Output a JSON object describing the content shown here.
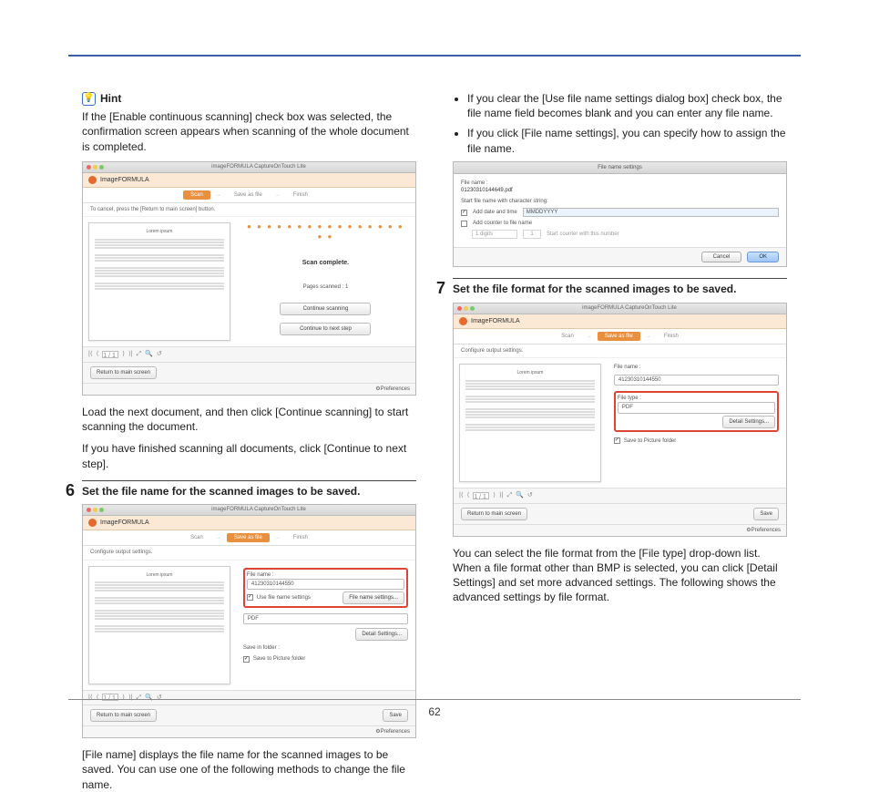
{
  "page_number": "62",
  "left": {
    "hint_label": "Hint",
    "hint_para": "If the [Enable continuous scanning] check box was selected, the confirmation screen appears when scanning of the whole document is completed.",
    "win1": {
      "titlebar": "imageFORMULA CaptureOnTouch Lite",
      "brand": "ImageFORMULA",
      "step_scan": "Scan",
      "step_save": "Save as file",
      "step_finish": "Finish",
      "subtext": "To cancel, press the [Return to main screen] button.",
      "preview_title": "Lorem ipsum",
      "scan_complete": "Scan complete.",
      "pages_scanned": "Pages scanned : 1",
      "btn_continue_scan": "Continue scanning",
      "btn_next_step": "Continue to next step",
      "btn_return": "Return to main screen",
      "toolbar_page": "1 / 1",
      "preferences": "Preferences"
    },
    "para_after_win1a": "Load the next document, and then click [Continue scanning] to start scanning the document.",
    "para_after_win1b": "If you have finished scanning all documents, click [Continue to next step].",
    "step6_num": "6",
    "step6_text": "Set the file name for the scanned images to be saved.",
    "win2": {
      "titlebar": "imageFORMULA CaptureOnTouch Lite",
      "brand": "ImageFORMULA",
      "step_scan": "Scan",
      "step_save": "Save as file",
      "step_finish": "Finish",
      "subtext": "Configure output settings.",
      "preview_title": "Lorem ipsum",
      "file_name_label": "File name :",
      "file_name_value": "41230310144550",
      "chk_use_settings": "Use file name settings",
      "btn_filename_settings": "File name settings...",
      "file_type_value": "PDF",
      "btn_detail": "Detail Settings...",
      "save_in_label": "Save in folder :",
      "chk_save_picture": "Save to Picture folder",
      "btn_return": "Return to main screen",
      "btn_save": "Save",
      "toolbar_page": "1 / 1",
      "preferences": "Preferences"
    },
    "para_after_win2": "[File name] displays the file name for the scanned images to be saved. You can use one of the following methods to change the file name."
  },
  "right": {
    "bullets": [
      "If you clear the [Use file name settings dialog box] check box, the file name field becomes blank and you can enter any file name.",
      "If you click [File name settings], you can specify how to assign the file name."
    ],
    "dlg": {
      "title": "File name settings",
      "file_name_label": "File name :",
      "file_name_value": "01230310144649.pdf",
      "start_label": "Start file name with character string:",
      "chk_date": "Add date and time",
      "date_value": "MMDDYYYY",
      "chk_counter": "Add counter to file name",
      "digits": "1 digits",
      "start_counter_label": "Start counter with this number",
      "start_counter_value": "1",
      "btn_cancel": "Cancel",
      "btn_ok": "OK"
    },
    "step7_num": "7",
    "step7_text": "Set the file format for the scanned images to be saved.",
    "win3": {
      "titlebar": "imageFORMULA CaptureOnTouch Lite",
      "brand": "ImageFORMULA",
      "step_scan": "Scan",
      "step_save": "Save as file",
      "step_finish": "Finish",
      "subtext": "Configure output settings.",
      "preview_title": "Lorem ipsum",
      "file_name_label": "File name :",
      "file_name_value": "41230310144550",
      "file_type_label": "File type :",
      "file_type_value": "PDF",
      "btn_detail": "Detail Settings...",
      "chk_save_picture": "Save to Picture folder",
      "btn_return": "Return to main screen",
      "btn_save": "Save",
      "toolbar_page": "1 / 1",
      "preferences": "Preferences"
    },
    "para_after_win3": "You can select the file format from the [File type] drop-down list. When a file format other than BMP is selected, you can click [Detail Settings] and set more advanced settings. The following shows the advanced settings by file format."
  }
}
